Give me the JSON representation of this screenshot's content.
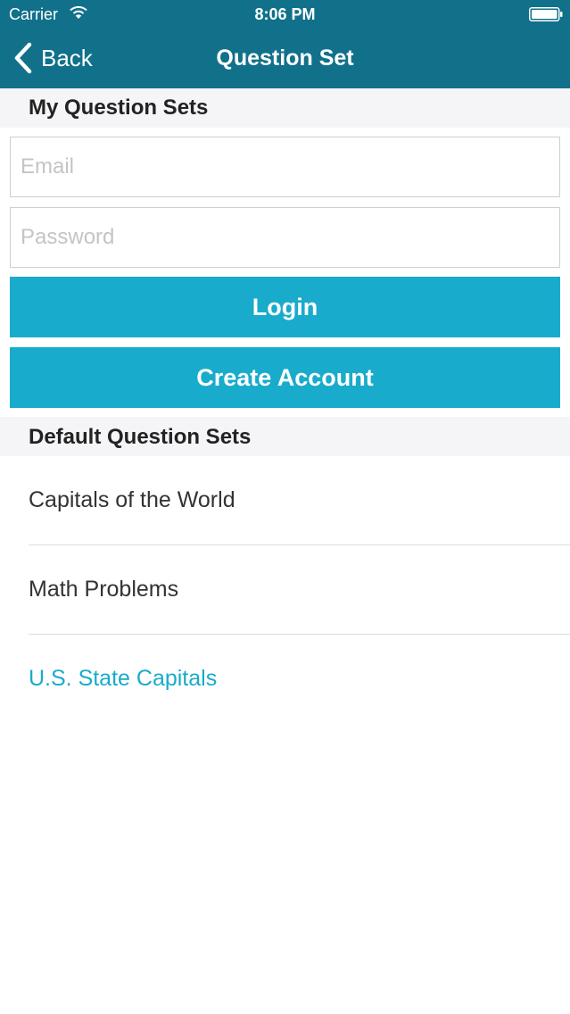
{
  "status_bar": {
    "carrier": "Carrier",
    "time": "8:06 PM"
  },
  "nav": {
    "back_label": "Back",
    "title": "Question Set"
  },
  "my_sets": {
    "header": "My Question Sets",
    "email_placeholder": "Email",
    "password_placeholder": "Password",
    "login_label": "Login",
    "create_account_label": "Create Account"
  },
  "default_sets": {
    "header": "Default Question Sets",
    "items": [
      {
        "label": "Capitals of the World"
      },
      {
        "label": "Math Problems"
      },
      {
        "label": "U.S. State Capitals"
      }
    ]
  },
  "colors": {
    "nav_background": "#11718a",
    "accent": "#19abcb",
    "section_background": "#f5f5f8"
  },
  "icons": [
    "wifi-icon",
    "battery-icon",
    "back-chevron-icon"
  ]
}
